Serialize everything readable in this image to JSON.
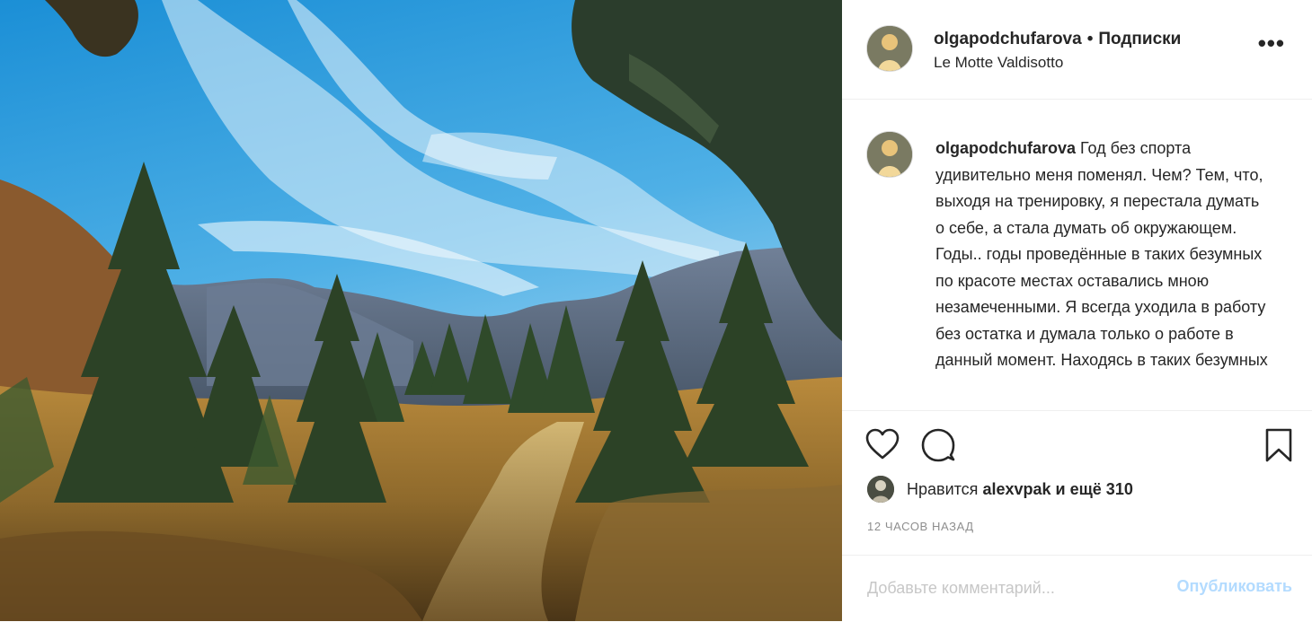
{
  "post": {
    "author": {
      "username": "olgapodchufarova",
      "separator": "•",
      "follow_state": "Подписки",
      "location": "Le Motte Valdisotto"
    },
    "more_label": "•••",
    "caption": {
      "username": "olgapodchufarova",
      "paragraph1": "Год без спорта удивительно меня поменял. Чем? Тем, что, выходя на тренировку, я перестала думать о себе, а стала думать об окружающем.",
      "paragraph2": "Годы.. годы проведённые в таких безумных по красоте местах оставались мною незамеченными. Я всегда уходила в работу без остатка и думала только о работе в данный момент. Находясь в таких безумных"
    },
    "icons": {
      "like": "heart-icon",
      "comment": "comment-icon",
      "save": "bookmark-icon"
    },
    "likes": {
      "prefix": "Нравится",
      "user": "alexvpak",
      "suffix": "и ещё 310"
    },
    "time_ago": "12 ЧАСОВ НАЗАД",
    "comment_box": {
      "placeholder": "Добавьте комментарий...",
      "publish_label": "Опубликовать"
    },
    "colors": {
      "text": "#262626",
      "muted": "#8e8e8e",
      "publish_disabled": "#b3dbff",
      "divider": "#efefef"
    }
  }
}
